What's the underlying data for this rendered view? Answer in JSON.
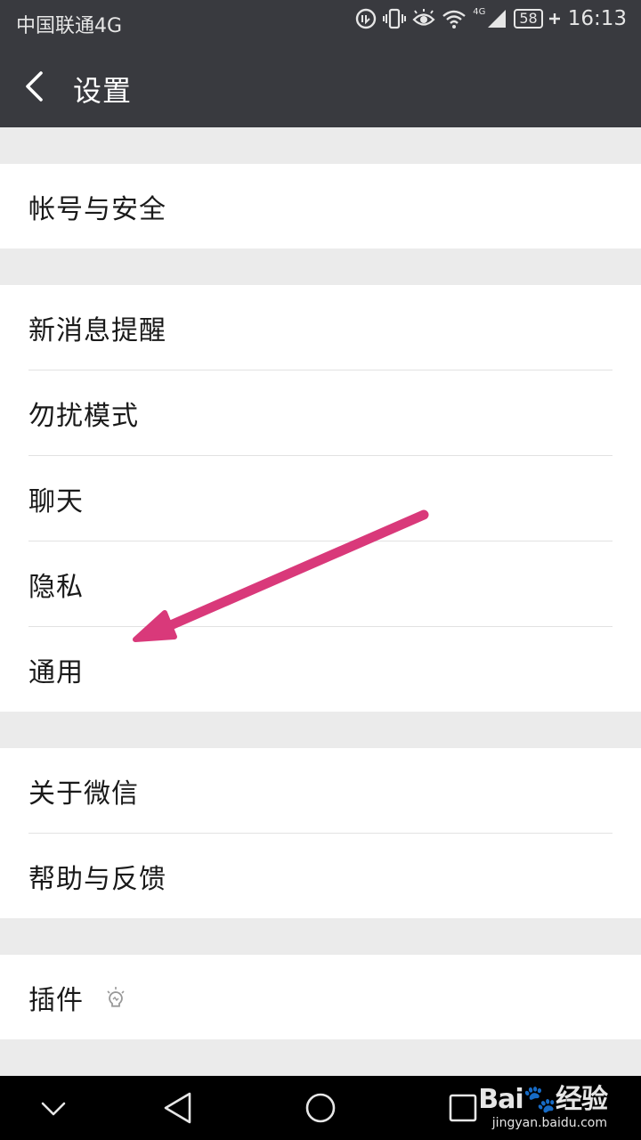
{
  "status_bar": {
    "carrier": "中国联通4G",
    "network_badge": "4G",
    "battery": "58",
    "time": "16:13"
  },
  "header": {
    "title": "设置"
  },
  "groups": [
    {
      "items": [
        {
          "label": "帐号与安全"
        }
      ]
    },
    {
      "items": [
        {
          "label": "新消息提醒"
        },
        {
          "label": "勿扰模式"
        },
        {
          "label": "聊天"
        },
        {
          "label": "隐私"
        },
        {
          "label": "通用"
        }
      ]
    },
    {
      "items": [
        {
          "label": "关于微信"
        },
        {
          "label": "帮助与反馈"
        }
      ]
    },
    {
      "items": [
        {
          "label": "插件"
        }
      ]
    }
  ],
  "watermark": {
    "brand": "Bai",
    "brand_suffix": "经验",
    "url": "jingyan.baidu.com"
  },
  "colors": {
    "header_bg": "#393a3f",
    "page_bg": "#ebebeb",
    "annotation_arrow": "#d9397a"
  }
}
